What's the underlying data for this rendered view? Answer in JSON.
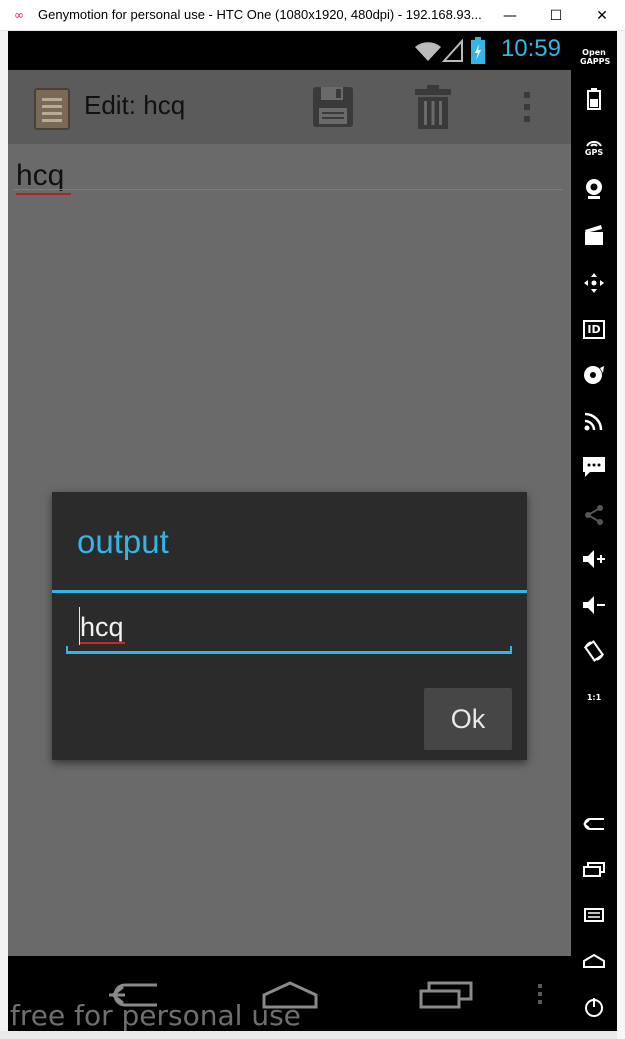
{
  "window": {
    "title": "Genymotion for personal use - HTC One (1080x1920, 480dpi) - 192.168.93...",
    "minimize_glyph": "—",
    "maximize_glyph": "☐",
    "close_glyph": "✕"
  },
  "status_bar": {
    "time": "10:59",
    "accent": "#33b5e5"
  },
  "action_bar": {
    "title": "Edit: hcq",
    "icons": [
      "notepad-icon",
      "save-icon",
      "delete-icon",
      "overflow-menu-icon"
    ]
  },
  "editor": {
    "text": "hcq"
  },
  "dialog": {
    "title": "output",
    "input_value": "hcq",
    "ok_label": "Ok"
  },
  "navigation": {
    "icons": [
      "back-icon",
      "home-icon",
      "recent-apps-icon",
      "menu-dots-icon"
    ]
  },
  "watermark": "free for personal use",
  "toolbar": {
    "open_gapps": "Open GAPPS",
    "gps": "GPS",
    "id": "ID",
    "ratio": "1:1",
    "icons": [
      "open-gapps-icon",
      "battery-icon",
      "gps-icon",
      "webcam-icon",
      "capture-icon",
      "dpad-icon",
      "id-icon",
      "disk-icon",
      "cast-icon",
      "sms-icon",
      "share-icon",
      "volume-up-icon",
      "volume-down-icon",
      "rotate-icon",
      "scale-icon",
      "back-icon",
      "recent-icon",
      "menu-icon",
      "home-icon",
      "power-icon"
    ]
  }
}
